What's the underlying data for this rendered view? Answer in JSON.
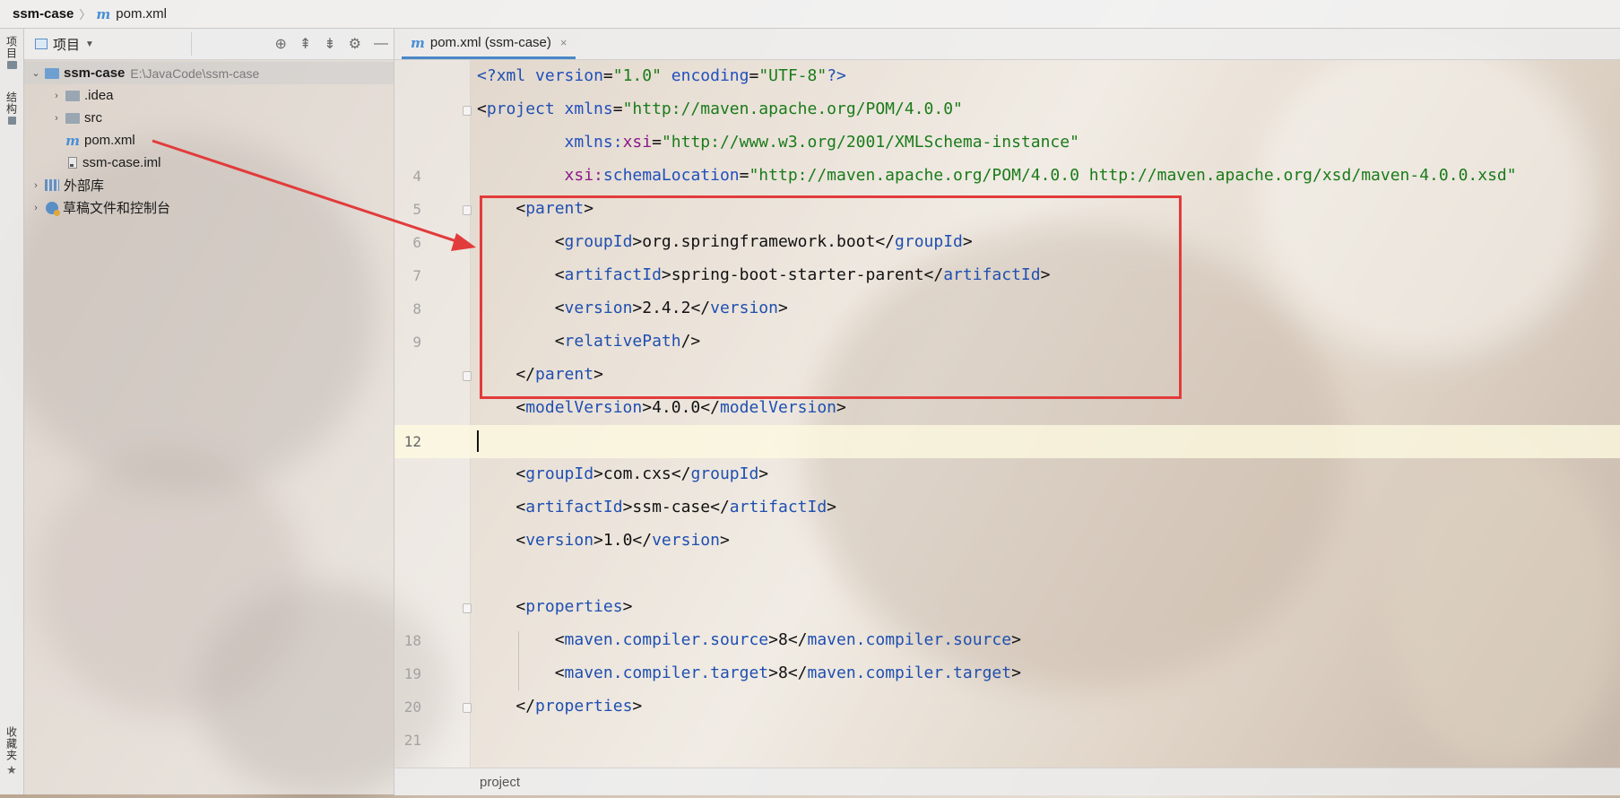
{
  "navbar": {
    "project": "ssm-case",
    "file_icon": "m",
    "file": "pom.xml"
  },
  "toolstrip": {
    "top_tab": "项目",
    "mid_tab": "结构",
    "bottom_tab": "收藏夹"
  },
  "panel": {
    "title": "项目",
    "tools": [
      "locate-icon",
      "expand-all-icon",
      "collapse-all-icon",
      "gear-icon",
      "minimize-icon"
    ],
    "tree": {
      "root": {
        "name": "ssm-case",
        "path": "E:\\JavaCode\\ssm-case"
      },
      "idea": ".idea",
      "src": "src",
      "pom": "pom.xml",
      "iml": "ssm-case.iml",
      "libs": "外部库",
      "scratches": "草稿文件和控制台"
    }
  },
  "tab": {
    "icon": "m",
    "label": "pom.xml (ssm-case)",
    "close": "×"
  },
  "editor": {
    "lines": {
      "l4": "4",
      "l5": "5",
      "l6": "6",
      "l7": "7",
      "l8": "8",
      "l9": "9",
      "l12": "12",
      "l18": "18",
      "l19": "19",
      "l20": "20",
      "l21": "21"
    },
    "xml_decl": {
      "open": "<?",
      "name": "xml",
      "version_attr": "version",
      "version_val": "\"1.0\"",
      "enc_attr": "encoding",
      "enc_val": "\"UTF-8\"",
      "close": "?>"
    },
    "project_open": {
      "tag": "project",
      "xmlns_attr": "xmlns",
      "xmlns_val": "\"http://maven.apache.org/POM/4.0.0\""
    },
    "xsi_line": {
      "ns": "xmlns:",
      "attr": "xsi",
      "val": "\"http://www.w3.org/2001/XMLSchema-instance\""
    },
    "schema_line": {
      "ns": "xsi:",
      "attr": "schemaLocation",
      "val": "\"http://maven.apache.org/POM/4.0.0 http://maven.apache.org/xsd/maven-4.0.0.xsd\""
    },
    "parent": {
      "tag": "parent",
      "group_tag": "groupId",
      "group_val": "org.springframework.boot",
      "artifact_tag": "artifactId",
      "artifact_val": "spring-boot-starter-parent",
      "version_tag": "version",
      "version_val": "2.4.2",
      "relpath_tag": "relativePath"
    },
    "model": {
      "tag": "modelVersion",
      "val": "4.0.0"
    },
    "coords": {
      "group_tag": "groupId",
      "group_val": "com.cxs",
      "artifact_tag": "artifactId",
      "artifact_val": "ssm-case",
      "version_tag": "version",
      "version_val": "1.0"
    },
    "properties": {
      "tag": "properties",
      "source_tag": "maven.compiler.source",
      "source_val": "8",
      "target_tag": "maven.compiler.target",
      "target_val": "8"
    }
  },
  "crumb": {
    "label": "project"
  },
  "colors": {
    "annotation": "#e23b3b",
    "tag": "#1f4fb0",
    "string": "#1a7b1a",
    "namespace": "#8a1a8a"
  }
}
